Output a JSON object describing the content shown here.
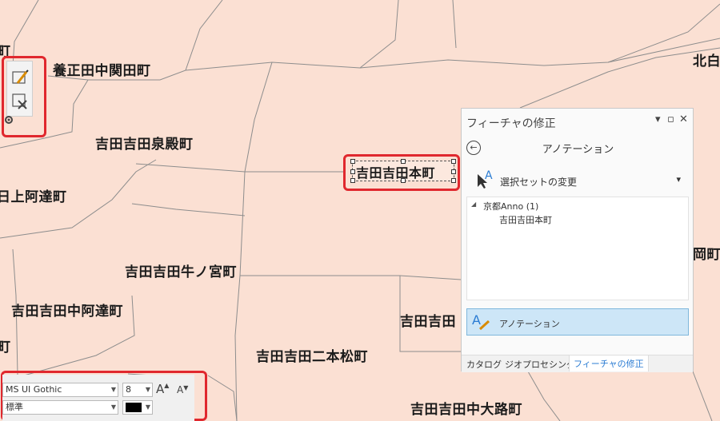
{
  "map": {
    "labels": [
      "町",
      "養正田中関田町",
      "北白",
      "吉田吉田泉殿町",
      "日上阿達町",
      "吉田吉田牛ノ宮町",
      "吉田吉田中阿達町",
      "町",
      "吉田吉田",
      "吉田吉田二本松町",
      "吉田吉田中大路町",
      "岡町"
    ],
    "selected_annotation": "吉田吉田本町"
  },
  "pane": {
    "title": "フィーチャの修正",
    "pin": "▾",
    "restore": "▫",
    "close": "✕",
    "back_glyph": "←",
    "subtitle": "アノテーション",
    "selection_change": "選択セットの変更",
    "dropdown": "▾",
    "tree": {
      "layer": "京都Anno (1)",
      "feature": "吉田吉田本町"
    },
    "tool_label": "アノテーション",
    "tabs": [
      "カタログ",
      "ジオプロセシング",
      "フィーチャの修正"
    ]
  },
  "text_toolbar": {
    "font": "MS UI Gothic",
    "size": "8",
    "style": "標準",
    "grow": "A",
    "shrink": "A",
    "color": "#000000"
  }
}
